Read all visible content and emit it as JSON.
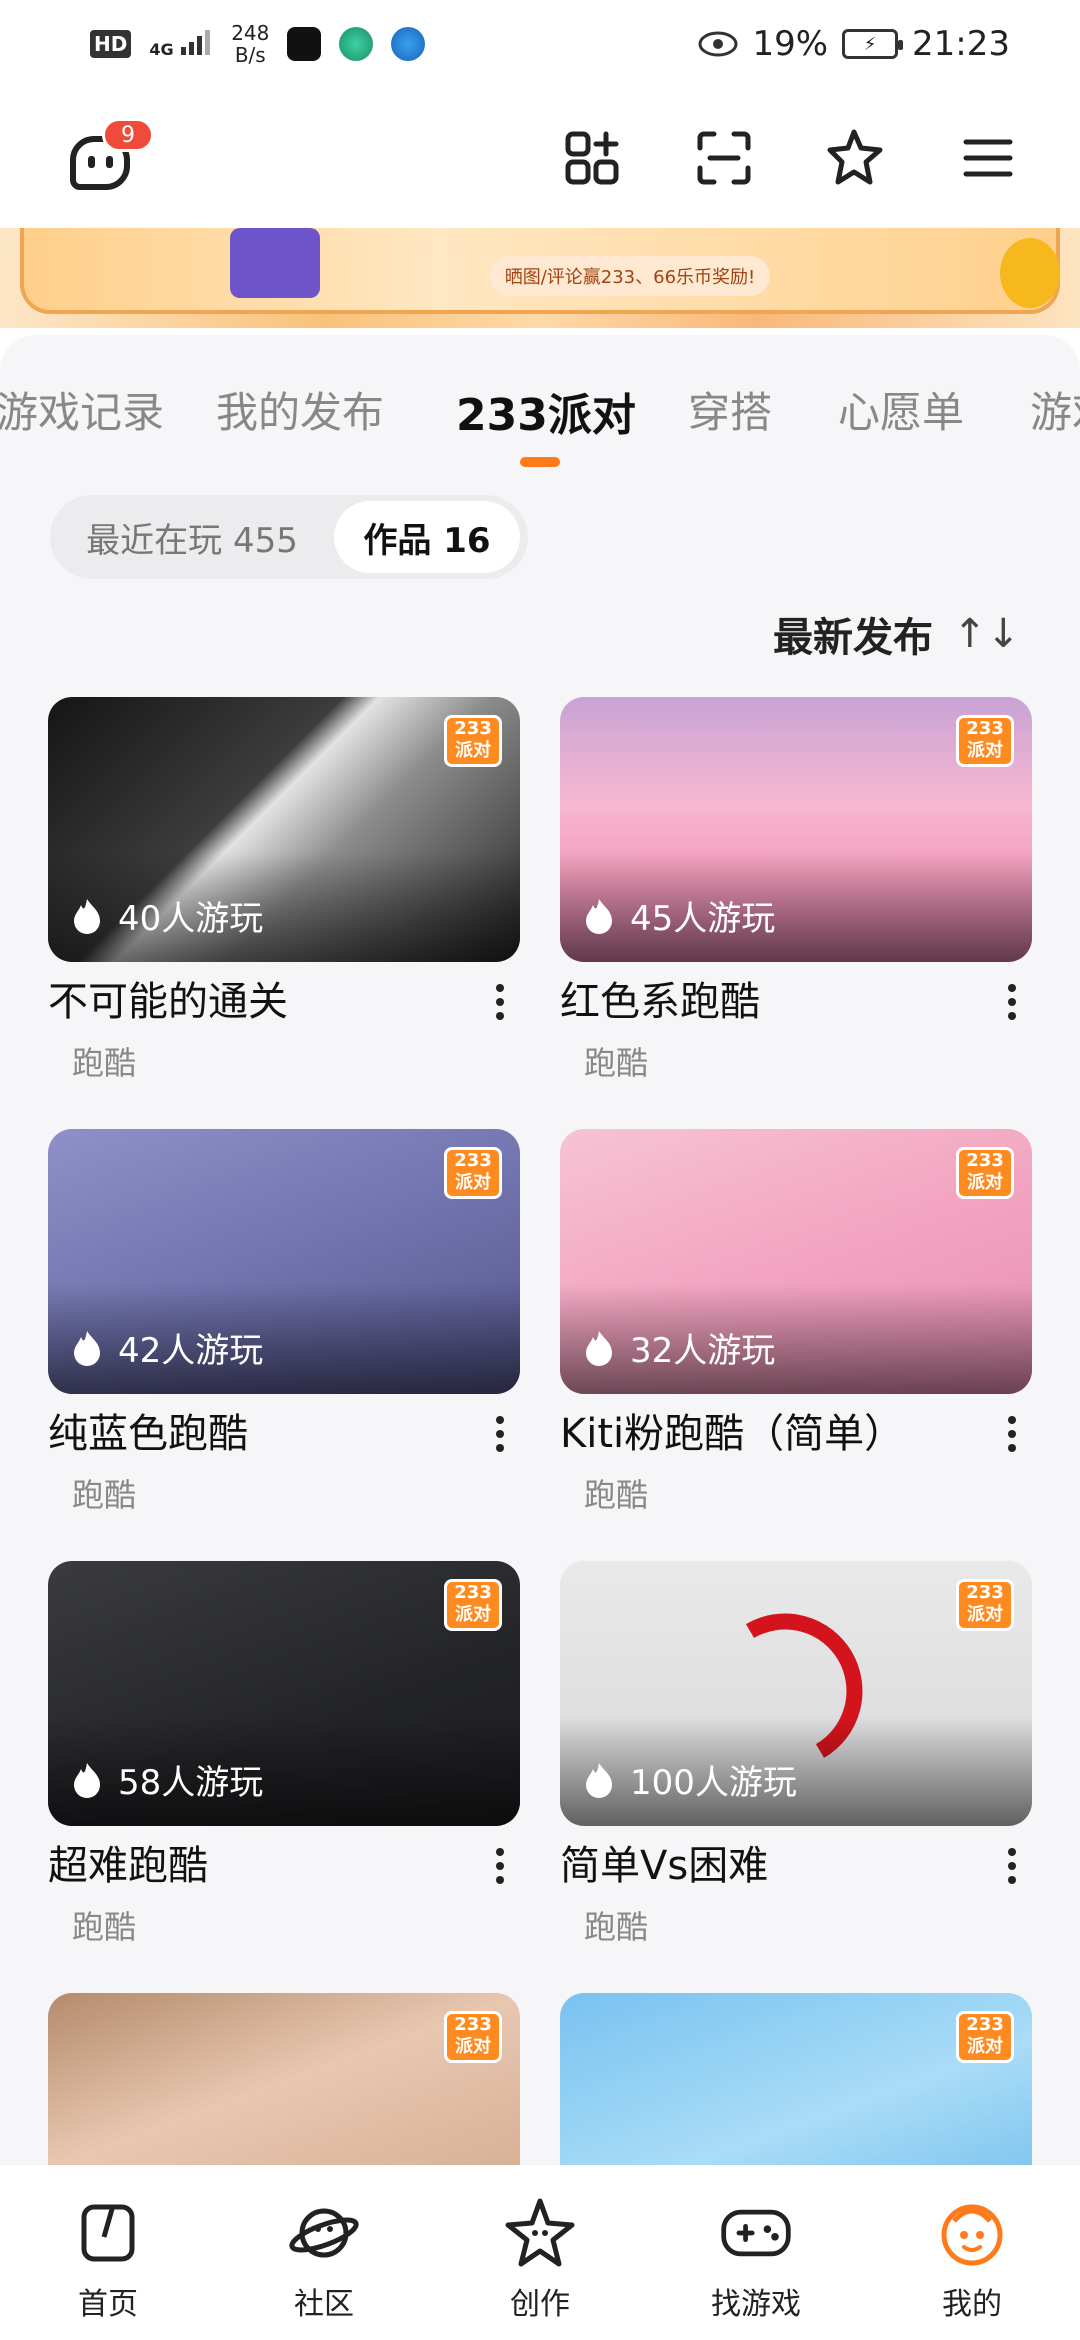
{
  "status_bar": {
    "hd": "HD",
    "signal": "4G",
    "speed_value": "248",
    "speed_unit": "B/s",
    "battery": "19%",
    "time": "21:23"
  },
  "header": {
    "notification_count": "9"
  },
  "banner": {
    "pill_text": "晒图/评论赢233、66乐币奖励!"
  },
  "tabs": [
    {
      "label": "游戏记录"
    },
    {
      "label": "我的发布"
    },
    {
      "label": "233派对",
      "active": true
    },
    {
      "label": "穿搭"
    },
    {
      "label": "心愿单"
    },
    {
      "label": "游戏"
    }
  ],
  "segment": {
    "recent": "最近在玩 455",
    "works": "作品 16"
  },
  "sort": {
    "label": "最新发布",
    "icon": "↑↓"
  },
  "cards": [
    {
      "title": "不可能的通关",
      "plays": "40人游玩",
      "tag": "跑酷"
    },
    {
      "title": "红色系跑酷",
      "plays": "45人游玩",
      "tag": "跑酷"
    },
    {
      "title": "纯蓝色跑酷",
      "plays": "42人游玩",
      "tag": "跑酷"
    },
    {
      "title": "Kiti粉跑酷（简单）",
      "plays": "32人游玩",
      "tag": "跑酷"
    },
    {
      "title": "超难跑酷",
      "plays": "58人游玩",
      "tag": "跑酷"
    },
    {
      "title": "简单Vs困难",
      "plays": "100人游玩",
      "tag": "跑酷"
    }
  ],
  "party_logo": "233派对",
  "bottom_nav": [
    {
      "label": "首页",
      "icon": "home-icon"
    },
    {
      "label": "社区",
      "icon": "planet-icon"
    },
    {
      "label": "创作",
      "icon": "star-create-icon"
    },
    {
      "label": "找游戏",
      "icon": "gamepad-icon"
    },
    {
      "label": "我的",
      "icon": "profile-icon",
      "active": true
    }
  ],
  "colors": {
    "accent": "#ff7a1a",
    "badge": "#f04b3a"
  }
}
